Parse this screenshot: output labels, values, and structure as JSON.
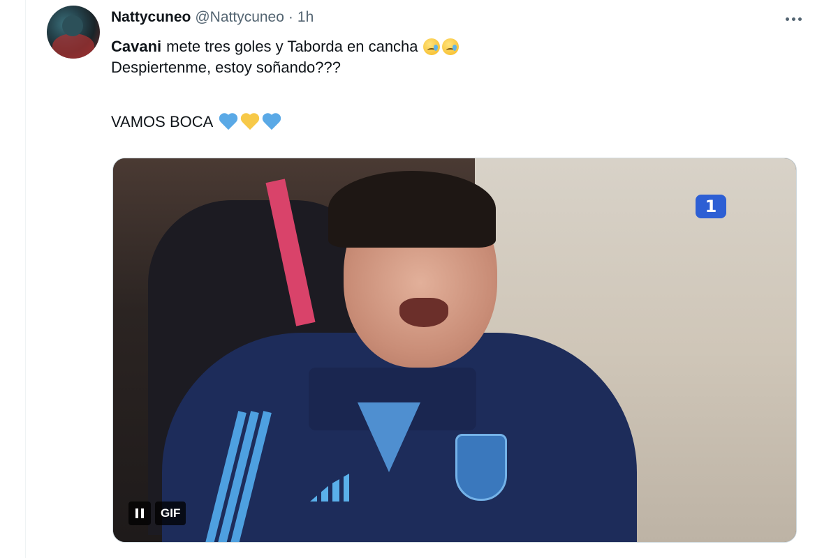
{
  "tweet": {
    "author": {
      "display_name": "Nattycuneo",
      "handle": "@Nattycuneo",
      "separator": "·",
      "time": "1h"
    },
    "more_icon": "more-horizontal-icon",
    "text": {
      "line1_bold": "Cavani",
      "line1_rest": "mete tres goles y Taborda en cancha",
      "line1_emojis": [
        "face-holding-back-tears",
        "face-holding-back-tears"
      ],
      "line2": "Despiertenme, estoy soñando???",
      "line3": "VAMOS BOCA",
      "line3_emojis": [
        "blue-heart",
        "yellow-heart",
        "blue-heart"
      ]
    },
    "colors": {
      "blue_heart": "#5aa9e6",
      "yellow_heart": "#f7c948",
      "channel_logo": "#2d5fd4"
    },
    "media": {
      "type": "GIF",
      "gif_label": "GIF",
      "channel_logo_text": "1",
      "pause_icon": "pause-icon"
    }
  }
}
